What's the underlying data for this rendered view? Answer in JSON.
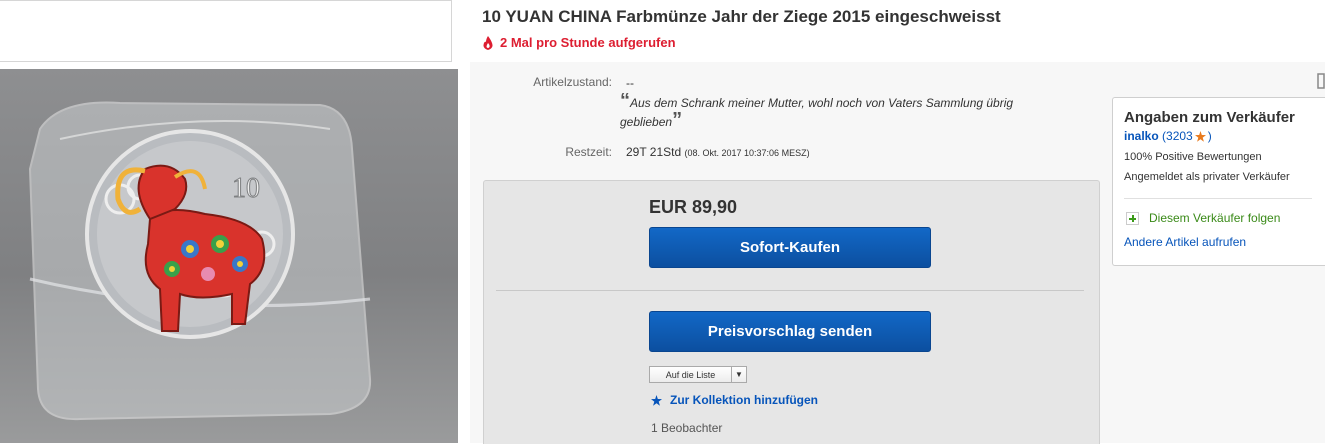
{
  "item": {
    "title": "10 YUAN CHINA Farbmünze Jahr der Ziege 2015 eingeschweisst",
    "views": "2 Mal pro Stunde aufgerufen"
  },
  "details": {
    "condition_label": "Artikelzustand:",
    "condition_value": "--",
    "quote_text": "Aus dem Schrank meiner Mutter, wohl noch von Vaters Sammlung übrig geblieben",
    "remaining_label": "Restzeit:",
    "remaining_value": "29T 21Std",
    "remaining_date": "(08. Okt. 2017   10:37:06 MESZ)"
  },
  "purchase": {
    "price": "EUR 89,90",
    "buy_now_label": "Sofort-Kaufen",
    "offer_label": "Preisvorschlag senden",
    "list_select_value": "Auf die Liste",
    "collection_label": "Zur Kollektion hinzufügen",
    "watchers": "1 Beobachter"
  },
  "seller": {
    "heading": "Angaben zum Verkäufer",
    "name": "inalko",
    "score_open": "(3203",
    "score_close": ")",
    "positive": "100% Positive Bewertungen",
    "registered": "Angemeldet als privater Verkäufer",
    "follow_label": "Diesem Verkäufer folgen",
    "other_items_label": "Andere Artikel aufrufen"
  },
  "colors": {
    "accent_blue": "#0654ba",
    "button_blue": "#0c5ab3",
    "views_red": "#dd1e31",
    "follow_green": "#3a8a18",
    "star_orange": "#e87a1e"
  },
  "icons": [
    "flame-icon",
    "star-icon",
    "plus-icon",
    "chevron-down-icon",
    "coin-photo"
  ]
}
